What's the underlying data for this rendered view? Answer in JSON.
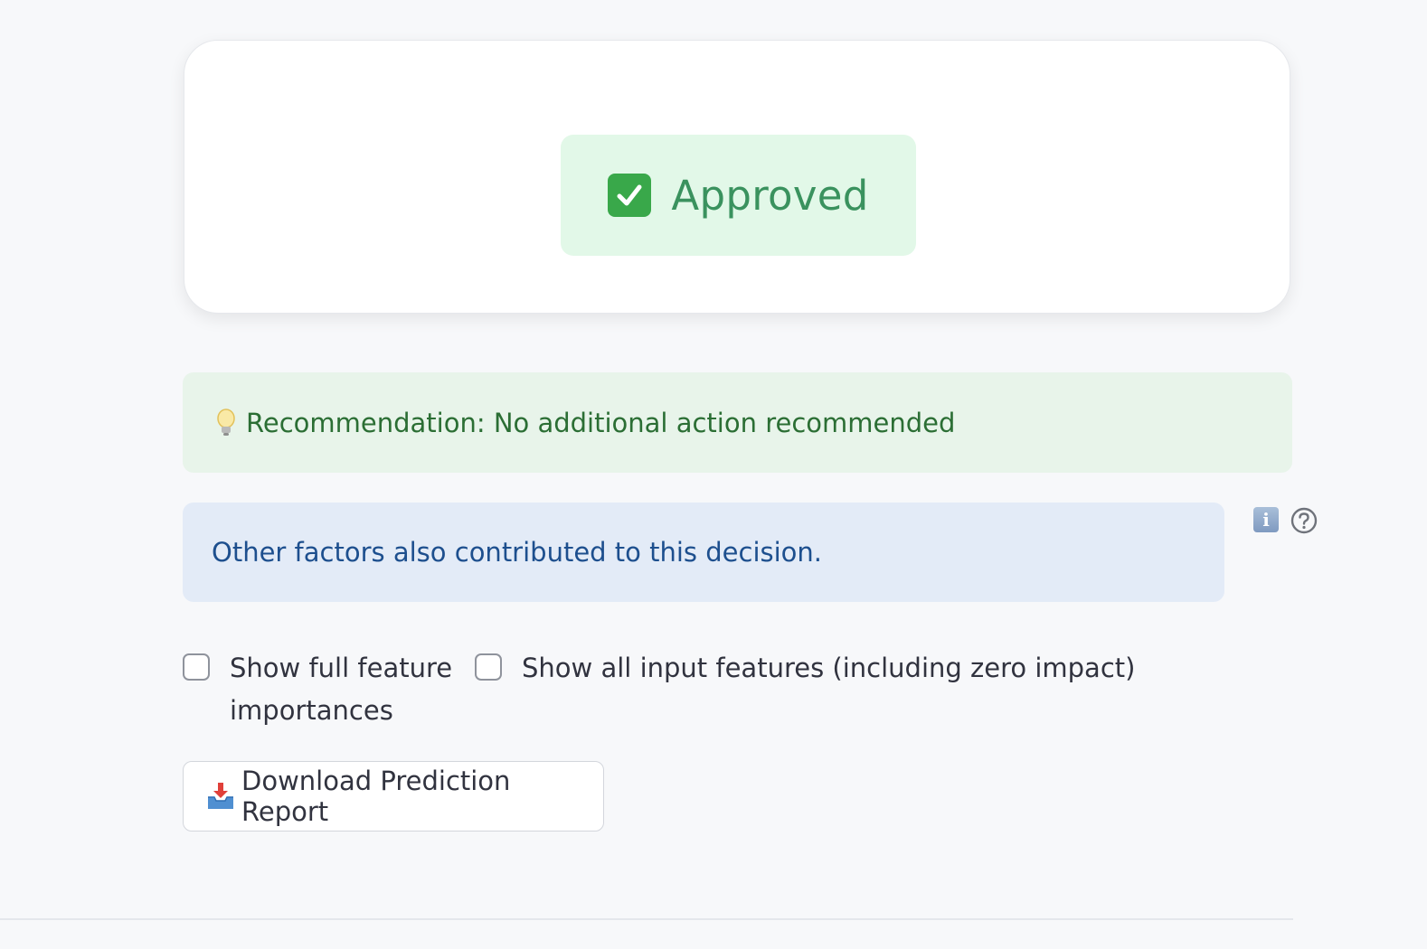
{
  "result": {
    "status_label": "Approved",
    "status_icon": "check-mark-button-icon",
    "status_color": "#3a925e"
  },
  "recommendation": {
    "text": "Recommendation: No additional action recommended",
    "icon": "light-bulb-icon"
  },
  "info": {
    "text": "Other factors also contributed to this decision.",
    "icon_info": "info-icon",
    "icon_help": "help-circle-icon"
  },
  "options": {
    "checkbox_full_importances": {
      "label": "Show full feature importances",
      "checked": false
    },
    "checkbox_all_features": {
      "label": "Show all input features (including zero impact)",
      "checked": false
    }
  },
  "actions": {
    "download_label": "Download Prediction Report",
    "download_icon": "inbox-tray-icon"
  }
}
